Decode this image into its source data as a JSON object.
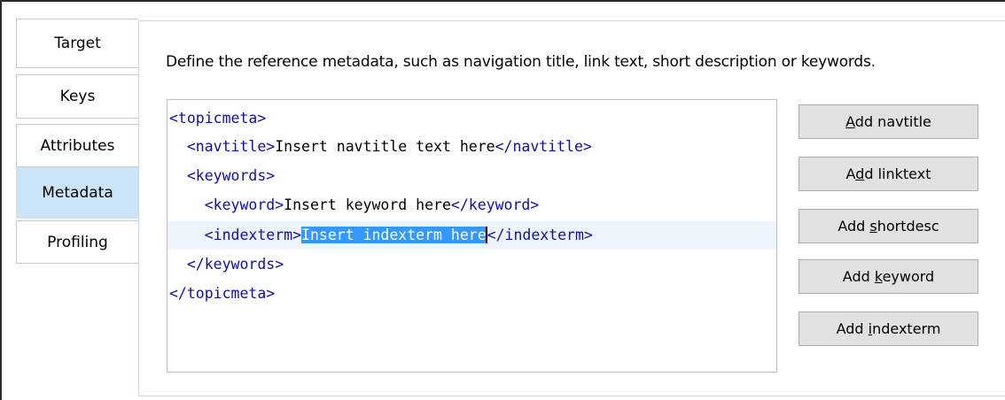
{
  "tabs": [
    {
      "label": "Target",
      "active": false
    },
    {
      "label": "Keys",
      "active": false
    },
    {
      "label": "Attributes",
      "active": false
    },
    {
      "label": "Metadata",
      "active": true
    },
    {
      "label": "Profiling",
      "active": false
    }
  ],
  "description": "Define the reference metadata, such as navigation title, link text, short description or keywords.",
  "editor": {
    "line1": "<topicmeta>",
    "line2": {
      "open": "<navtitle>",
      "text": "Insert navtitle text here",
      "close": "</navtitle>"
    },
    "line3": "<keywords>",
    "line4": {
      "open": "<keyword>",
      "text": "Insert keyword here",
      "close": "</keyword>"
    },
    "line5": {
      "open": "<indexterm>",
      "selected": "Insert indexterm here",
      "close": "</indexterm>"
    },
    "line6": "</keywords>",
    "line7": "</topicmeta>"
  },
  "buttons": [
    {
      "pre": "",
      "mn": "A",
      "post": "dd navtitle"
    },
    {
      "pre": "A",
      "mn": "d",
      "post": "d linktext"
    },
    {
      "pre": "Add ",
      "mn": "s",
      "post": "hortdesc"
    },
    {
      "pre": "Add ",
      "mn": "k",
      "post": "eyword"
    },
    {
      "pre": "Add ",
      "mn": "i",
      "post": "ndexterm"
    }
  ],
  "colors": {
    "tag": "#1010a0",
    "selection": "#3399ff",
    "active_tab": "#cce4f7",
    "button": "#e1e1e1"
  }
}
